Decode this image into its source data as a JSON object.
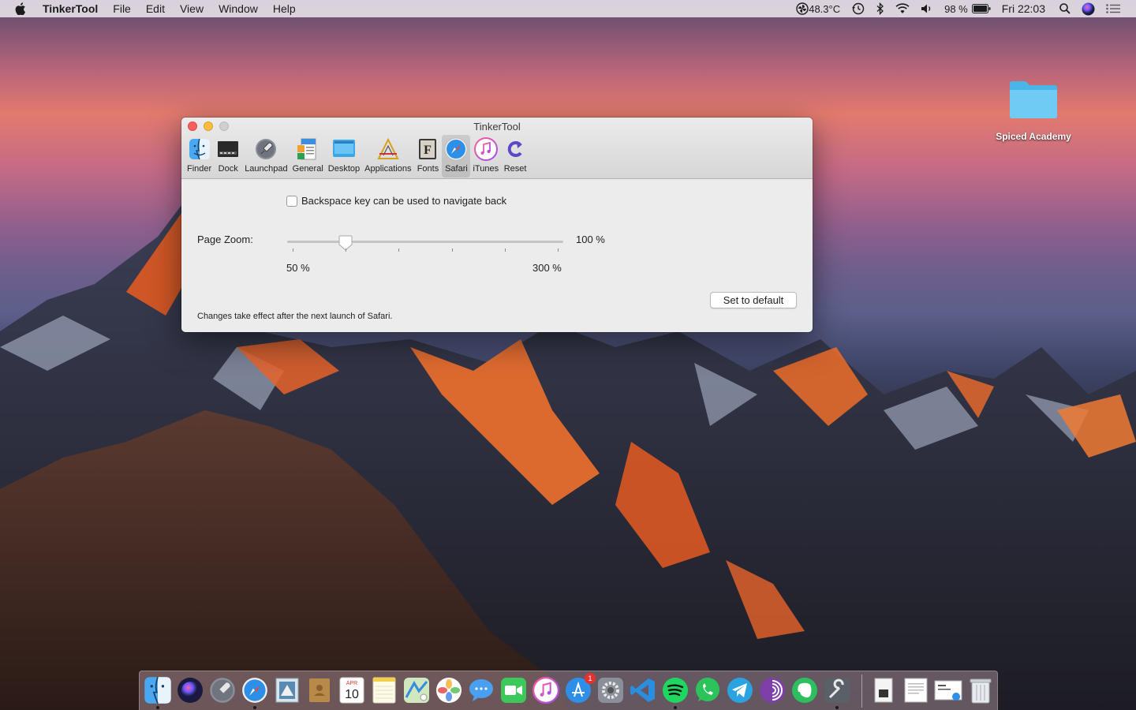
{
  "menubar": {
    "app_name": "TinkerTool",
    "items": [
      "File",
      "Edit",
      "View",
      "Window",
      "Help"
    ],
    "temperature": "48.3°C",
    "battery": "98 %",
    "clock": "Fri 22:03"
  },
  "desktop": {
    "folder_label": "Spiced Academy"
  },
  "window": {
    "title": "TinkerTool",
    "toolbar": [
      "Finder",
      "Dock",
      "Launchpad",
      "General",
      "Desktop",
      "Applications",
      "Fonts",
      "Safari",
      "iTunes",
      "Reset"
    ],
    "selected_tab": "Safari",
    "checkbox_label": "Backspace key can be used to navigate back",
    "checkbox_checked": false,
    "page_zoom_label": "Page Zoom:",
    "page_zoom_value": "100 %",
    "slider_min_label": "50 %",
    "slider_max_label": "300 %",
    "slider_value": 100,
    "slider_min": 50,
    "slider_max": 300,
    "default_button": "Set to default",
    "footnote": "Changes take effect after the next launch of Safari."
  },
  "dock": {
    "calendar_month": "APR",
    "calendar_day": "10",
    "appstore_badge": "1"
  }
}
